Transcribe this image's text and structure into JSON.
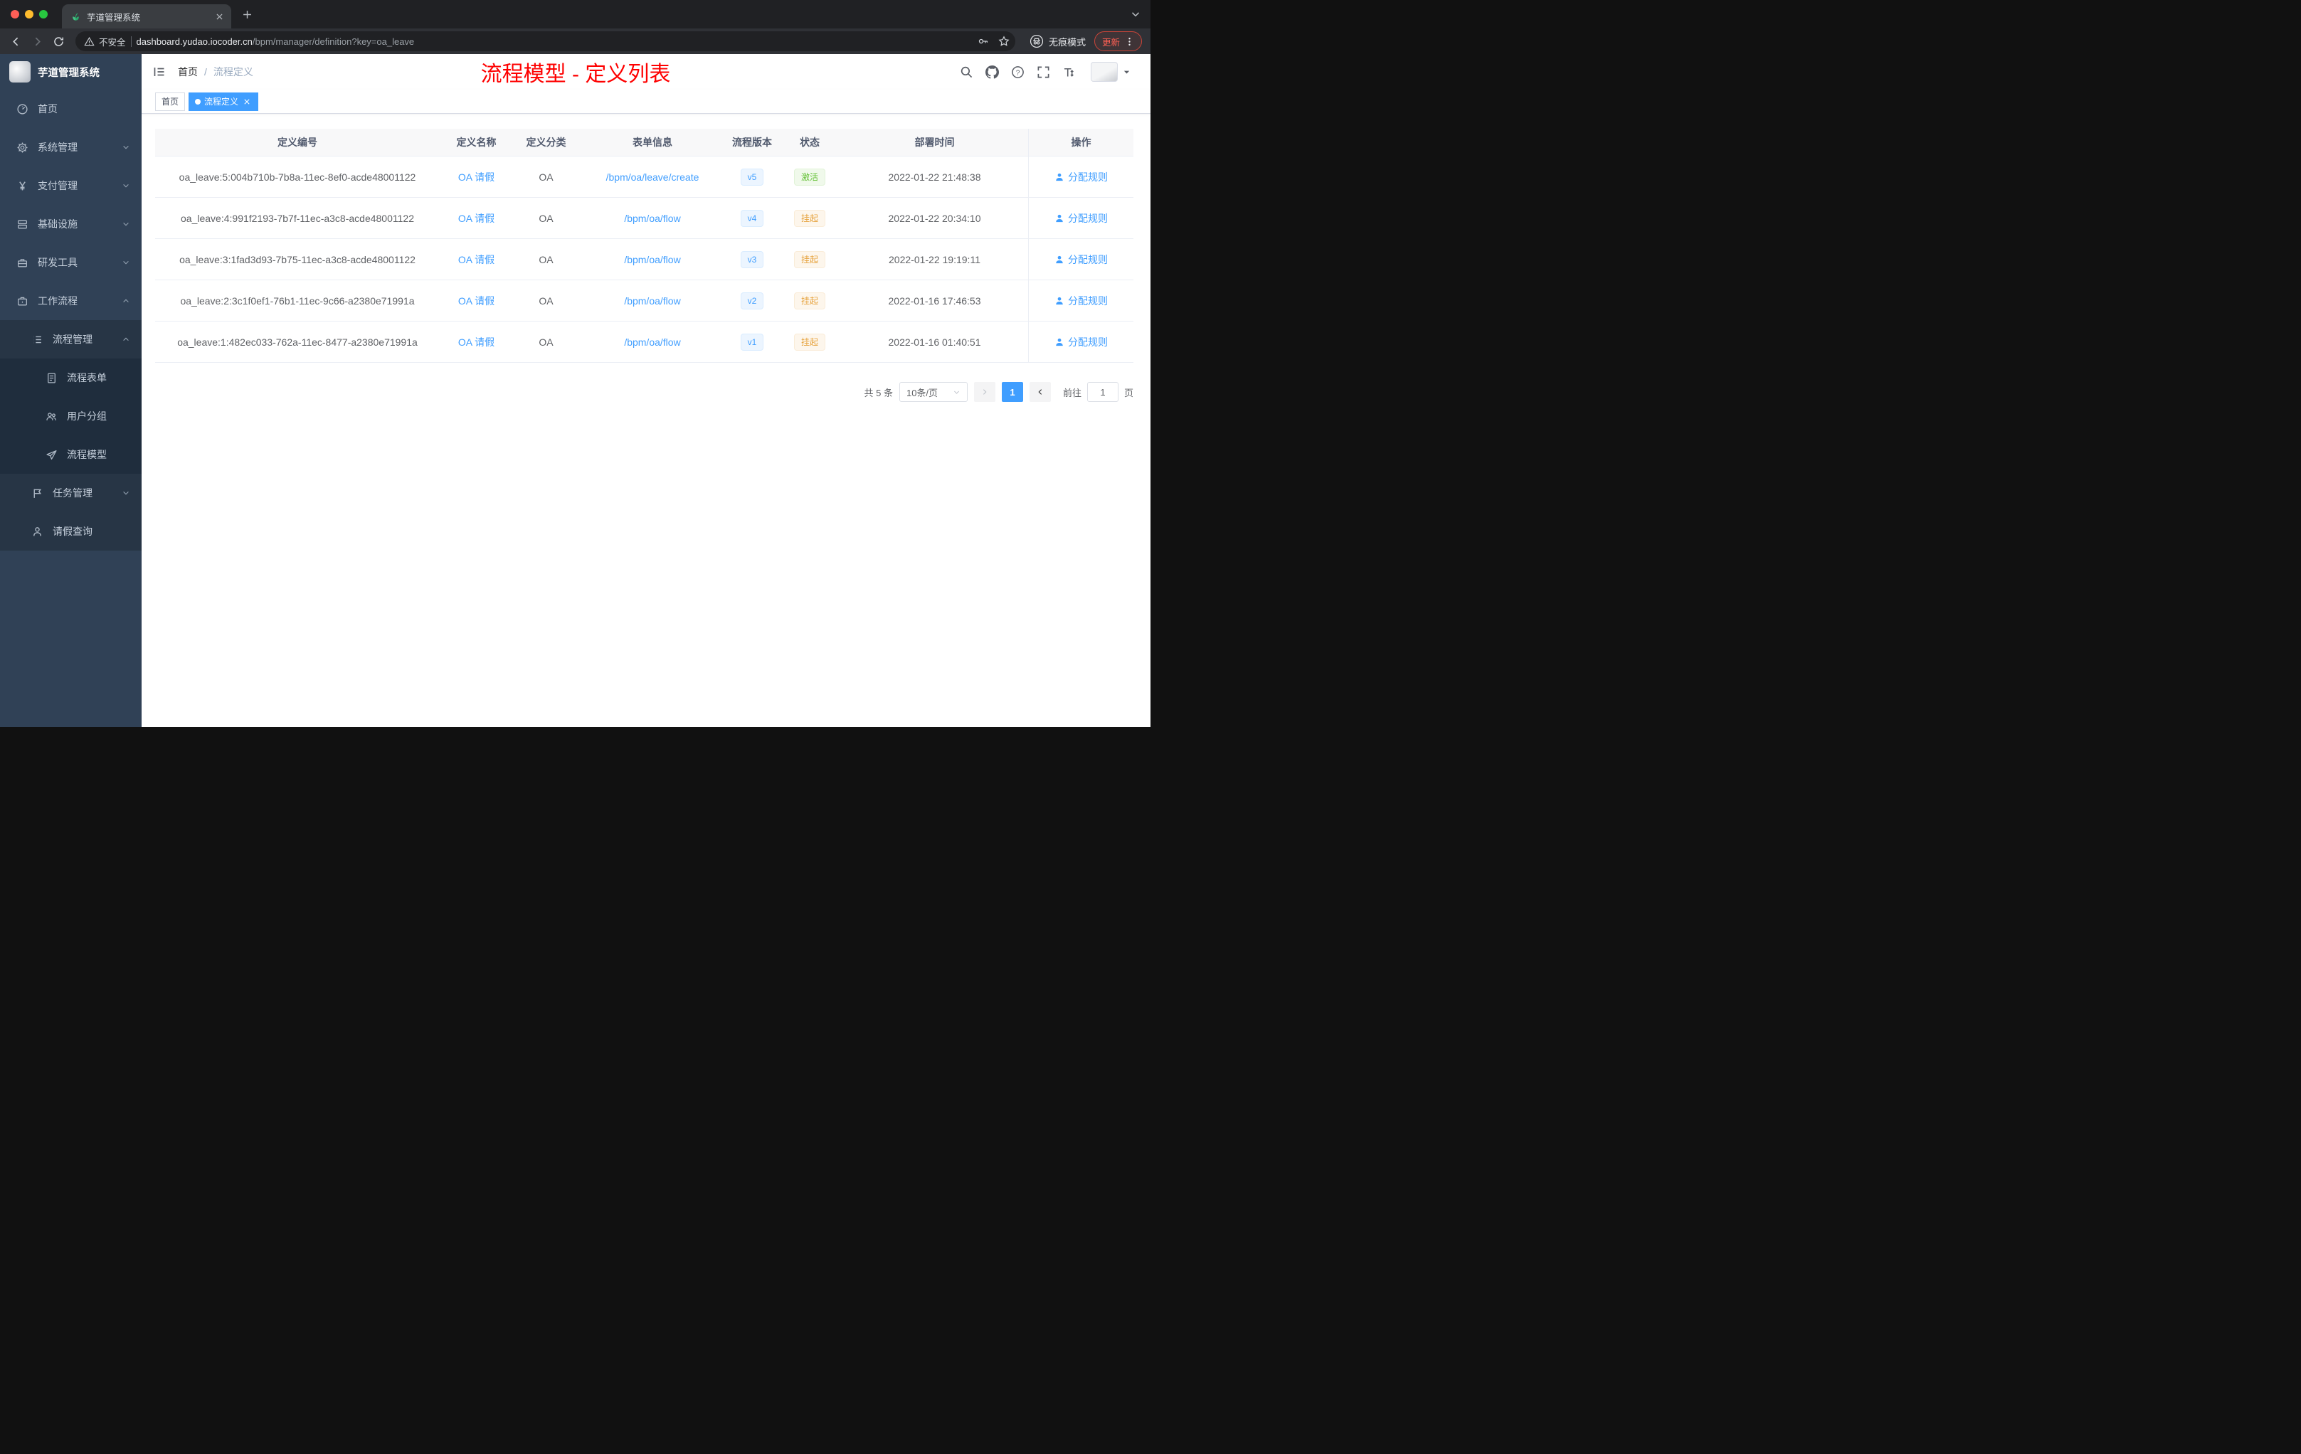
{
  "colors": {
    "accent": "#409eff",
    "success": "#67c23a",
    "warning": "#e6a23c",
    "page_title_red": "#fe0000",
    "sidebar_bg": "#304156"
  },
  "icons": {
    "favicon": "green-sprout",
    "security": "warning-triangle",
    "incognito": "spy-badge",
    "action": "user-silhouette"
  },
  "browser": {
    "tab_title": "芋道管理系统",
    "security_label": "不安全",
    "url_host": "dashboard.yudao.iocoder.cn",
    "url_path": "/bpm/manager/definition?key=oa_leave",
    "incognito_label": "无痕模式",
    "update_label": "更新"
  },
  "sidebar": {
    "logo_title": "芋道管理系统",
    "items": [
      {
        "label": "首页",
        "icon": "gauge",
        "level": 1,
        "arrow": null
      },
      {
        "label": "系统管理",
        "icon": "gear",
        "level": 1,
        "arrow": "down"
      },
      {
        "label": "支付管理",
        "icon": "yen",
        "level": 1,
        "arrow": "down"
      },
      {
        "label": "基础设施",
        "icon": "server",
        "level": 1,
        "arrow": "down"
      },
      {
        "label": "研发工具",
        "icon": "toolbox",
        "level": 1,
        "arrow": "down"
      },
      {
        "label": "工作流程",
        "icon": "briefcase",
        "level": 1,
        "arrow": "up"
      },
      {
        "label": "流程管理",
        "icon": "list",
        "level": 2,
        "arrow": "up"
      },
      {
        "label": "流程表单",
        "icon": "document",
        "level": 3,
        "arrow": null
      },
      {
        "label": "用户分组",
        "icon": "users",
        "level": 3,
        "arrow": null
      },
      {
        "label": "流程模型",
        "icon": "plane",
        "level": 3,
        "arrow": null
      },
      {
        "label": "任务管理",
        "icon": "flag",
        "level": 2,
        "arrow": "down"
      },
      {
        "label": "请假查询",
        "icon": "person",
        "level": 2,
        "arrow": null
      }
    ]
  },
  "header": {
    "breadcrumb_home": "首页",
    "breadcrumb_separator": "/",
    "breadcrumb_current": "流程定义",
    "page_title": "流程模型 - 定义列表"
  },
  "tags": {
    "items": [
      {
        "label": "首页",
        "active": false,
        "closable": false
      },
      {
        "label": "流程定义",
        "active": true,
        "closable": true
      }
    ]
  },
  "table": {
    "columns": [
      "定义编号",
      "定义名称",
      "定义分类",
      "表单信息",
      "流程版本",
      "状态",
      "部署时间",
      "操作"
    ],
    "rows": [
      {
        "id": "oa_leave:5:004b710b-7b8a-11ec-8ef0-acde48001122",
        "name": "OA 请假",
        "category": "OA",
        "form": "/bpm/oa/leave/create",
        "version": "v5",
        "status": "激活",
        "status_type": "success",
        "deploy_time": "2022-01-22 21:48:38",
        "action": "分配规则"
      },
      {
        "id": "oa_leave:4:991f2193-7b7f-11ec-a3c8-acde48001122",
        "name": "OA 请假",
        "category": "OA",
        "form": "/bpm/oa/flow",
        "version": "v4",
        "status": "挂起",
        "status_type": "warning",
        "deploy_time": "2022-01-22 20:34:10",
        "action": "分配规则"
      },
      {
        "id": "oa_leave:3:1fad3d93-7b75-11ec-a3c8-acde48001122",
        "name": "OA 请假",
        "category": "OA",
        "form": "/bpm/oa/flow",
        "version": "v3",
        "status": "挂起",
        "status_type": "warning",
        "deploy_time": "2022-01-22 19:19:11",
        "action": "分配规则"
      },
      {
        "id": "oa_leave:2:3c1f0ef1-76b1-11ec-9c66-a2380e71991a",
        "name": "OA 请假",
        "category": "OA",
        "form": "/bpm/oa/flow",
        "version": "v2",
        "status": "挂起",
        "status_type": "warning",
        "deploy_time": "2022-01-16 17:46:53",
        "action": "分配规则"
      },
      {
        "id": "oa_leave:1:482ec033-762a-11ec-8477-a2380e71991a",
        "name": "OA 请假",
        "category": "OA",
        "form": "/bpm/oa/flow",
        "version": "v1",
        "status": "挂起",
        "status_type": "warning",
        "deploy_time": "2022-01-16 01:40:51",
        "action": "分配规则"
      }
    ]
  },
  "pagination": {
    "total_text": "共 5 条",
    "page_size_text": "10条/页",
    "current_page": "1",
    "goto_prefix": "前往",
    "goto_value": "1",
    "goto_suffix": "页"
  }
}
